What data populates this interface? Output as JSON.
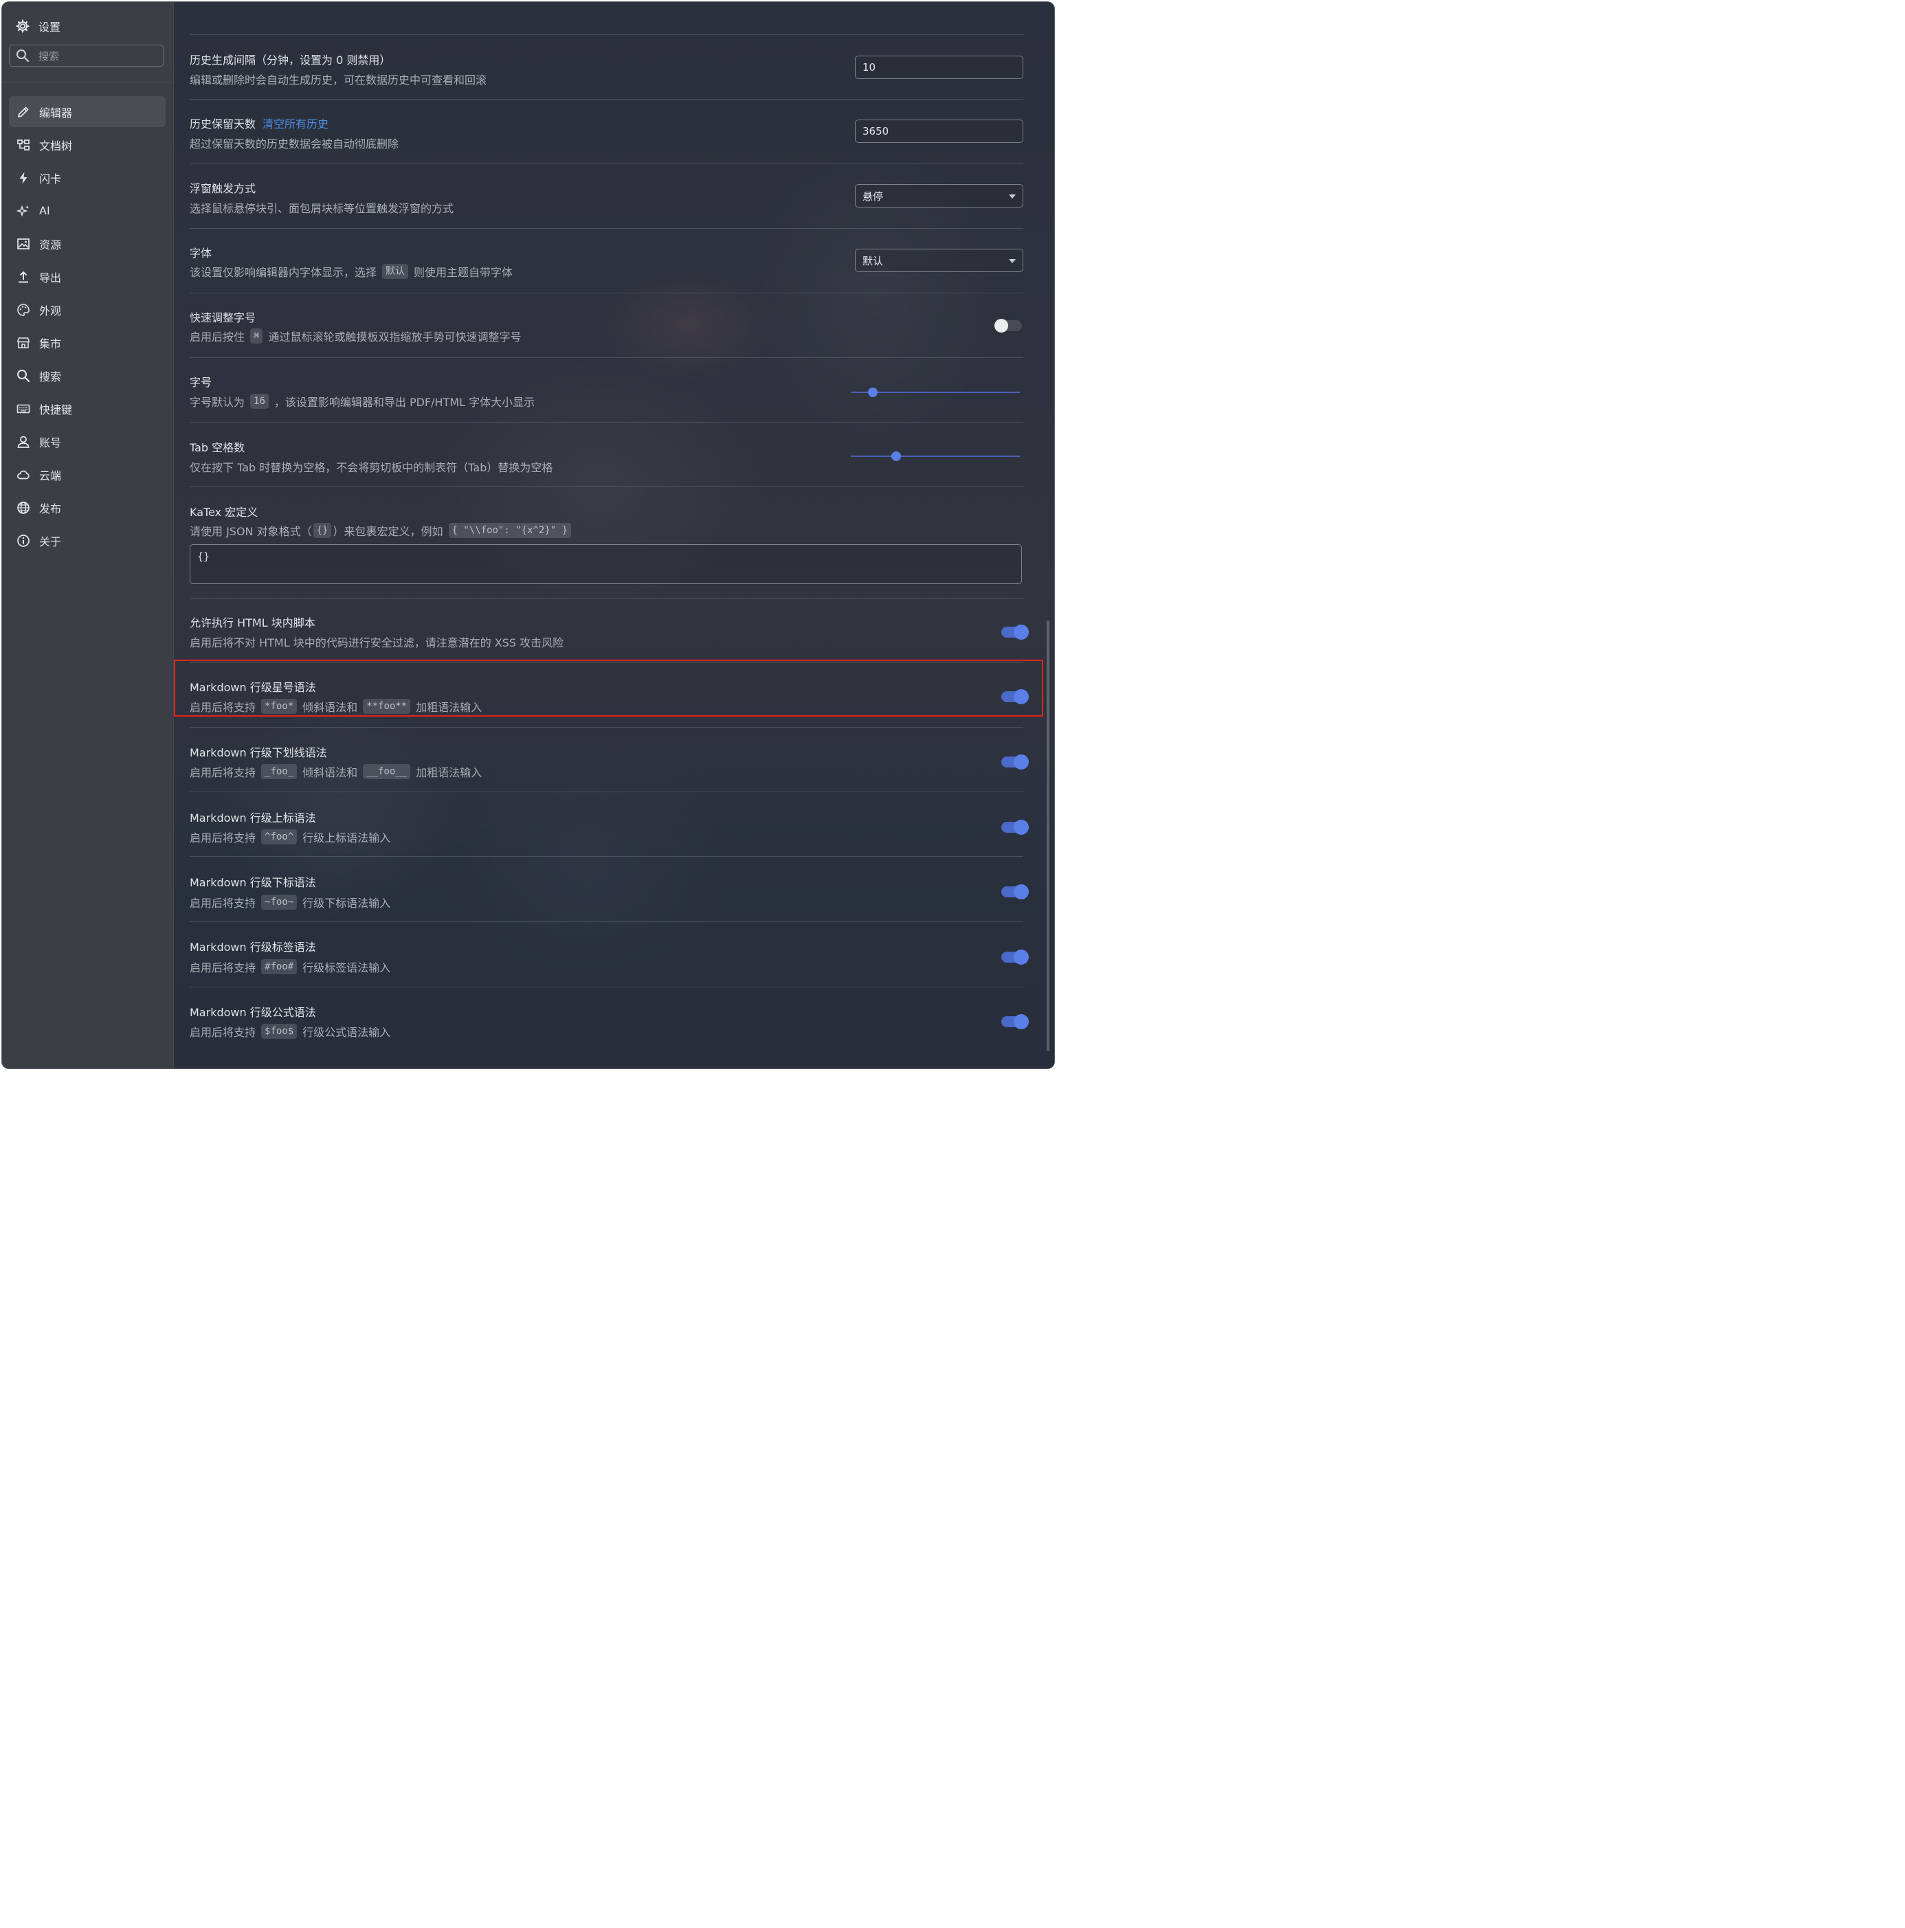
{
  "sidebar": {
    "title": "设置",
    "search_placeholder": "搜索",
    "items": [
      {
        "label": "编辑器",
        "icon": "pencil-icon"
      },
      {
        "label": "文档树",
        "icon": "doctree-icon"
      },
      {
        "label": "闪卡",
        "icon": "lightning-icon"
      },
      {
        "label": "AI",
        "icon": "sparkle-icon"
      },
      {
        "label": "资源",
        "icon": "image-icon"
      },
      {
        "label": "导出",
        "icon": "export-icon"
      },
      {
        "label": "外观",
        "icon": "palette-icon"
      },
      {
        "label": "集市",
        "icon": "store-icon"
      },
      {
        "label": "搜索",
        "icon": "search-icon"
      },
      {
        "label": "快捷键",
        "icon": "keyboard-icon"
      },
      {
        "label": "账号",
        "icon": "user-icon"
      },
      {
        "label": "云端",
        "icon": "cloud-icon"
      },
      {
        "label": "发布",
        "icon": "globe-icon"
      },
      {
        "label": "关于",
        "icon": "info-icon"
      }
    ]
  },
  "settings": {
    "history_interval": {
      "title": "历史生成间隔（分钟，设置为 0 则禁用）",
      "desc": "编辑或删除时会自动生成历史，可在数据历史中可查看和回滚",
      "value": "10"
    },
    "history_keep_days": {
      "title": "历史保留天数",
      "link": "清空所有历史",
      "desc": "超过保留天数的历史数据会被自动彻底删除",
      "value": "3650"
    },
    "float_trigger": {
      "title": "浮窗触发方式",
      "desc": "选择鼠标悬停块引、面包屑块标等位置触发浮窗的方式",
      "value": "悬停"
    },
    "font": {
      "title": "字体",
      "desc_a": "该设置仅影响编辑器内字体显示，选择",
      "code": "默认",
      "desc_b": "则使用主题自带字体",
      "value": "默认"
    },
    "quick_font_size": {
      "title": "快速调整字号",
      "desc_a": "启用后按住",
      "code": "⌘",
      "desc_b": "通过鼠标滚轮或触摸板双指缩放手势可快速调整字号",
      "enabled": false
    },
    "font_size": {
      "title": "字号",
      "desc_a": "字号默认为",
      "code": "16",
      "desc_b": "，该设置影响编辑器和导出 PDF/HTML 字体大小显示",
      "level": 0.13
    },
    "tab_space": {
      "title": "Tab 空格数",
      "desc": "仅在按下 Tab 时替换为空格，不会将剪切板中的制表符（Tab）替换为空格",
      "level": 0.27
    },
    "katex": {
      "title": "KaTex 宏定义",
      "desc_a": "请使用 JSON 对象格式（",
      "code_a": "{}",
      "desc_b": "）来包裹宏定义，例如",
      "code_b": "{ \"\\\\foo\": \"{x^2}\" }",
      "value": "{}"
    },
    "allow_html": {
      "title": "允许执行 HTML 块内脚本",
      "desc": "启用后将不对 HTML 块中的代码进行安全过滤，请注意潜在的 XSS 攻击风险",
      "enabled": true
    },
    "inline_asterisk": {
      "title": "Markdown 行级星号语法",
      "desc_a": "启用后将支持",
      "code_a": "*foo*",
      "desc_b": "倾斜语法和",
      "code_b": "**foo**",
      "desc_c": "加粗语法输入",
      "enabled": true
    },
    "inline_underscore": {
      "title": "Markdown 行级下划线语法",
      "desc_a": "启用后将支持",
      "code_a": "_foo_",
      "desc_b": "倾斜语法和",
      "code_b": "__foo__",
      "desc_c": "加粗语法输入",
      "enabled": true
    },
    "inline_sup": {
      "title": "Markdown 行级上标语法",
      "desc_a": "启用后将支持",
      "code": "^foo^",
      "desc_b": "行级上标语法输入",
      "enabled": true
    },
    "inline_sub": {
      "title": "Markdown 行级下标语法",
      "desc_a": "启用后将支持",
      "code": "~foo~",
      "desc_b": "行级下标语法输入",
      "enabled": true
    },
    "inline_tag": {
      "title": "Markdown 行级标签语法",
      "desc_a": "启用后将支持",
      "code": "#foo#",
      "desc_b": "行级标签语法输入",
      "enabled": true
    },
    "inline_math": {
      "title": "Markdown 行级公式语法",
      "desc_a": "启用后将支持",
      "code": "$foo$",
      "desc_b": "行级公式语法输入",
      "enabled": true
    }
  },
  "colors": {
    "accent": "#5b7fe8",
    "highlight": "#e0251c",
    "link": "#4f8de8"
  }
}
